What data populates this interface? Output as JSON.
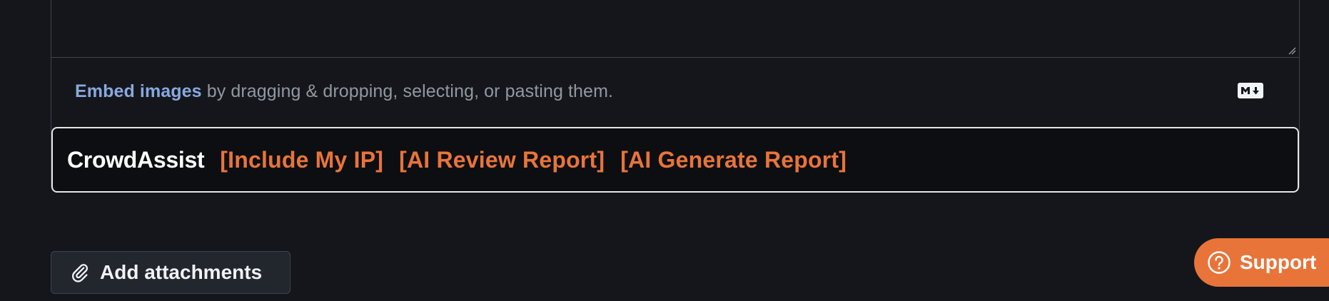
{
  "editor": {
    "embed_link": "Embed images",
    "embed_text": " by dragging & dropping, selecting, or pasting them."
  },
  "crowdassist": {
    "title": "CrowdAssist",
    "links": [
      "[Include My IP]",
      "[AI Review Report]",
      "[AI Generate Report]"
    ]
  },
  "attachments": {
    "label": "Add attachments"
  },
  "support": {
    "label": "Support"
  },
  "colors": {
    "background": "#15161b",
    "accent_orange": "#e8743a",
    "link_blue": "#87a9e0"
  },
  "icons": [
    "resize-grip-icon",
    "markdown-icon",
    "paperclip-icon",
    "help-circle-icon"
  ]
}
